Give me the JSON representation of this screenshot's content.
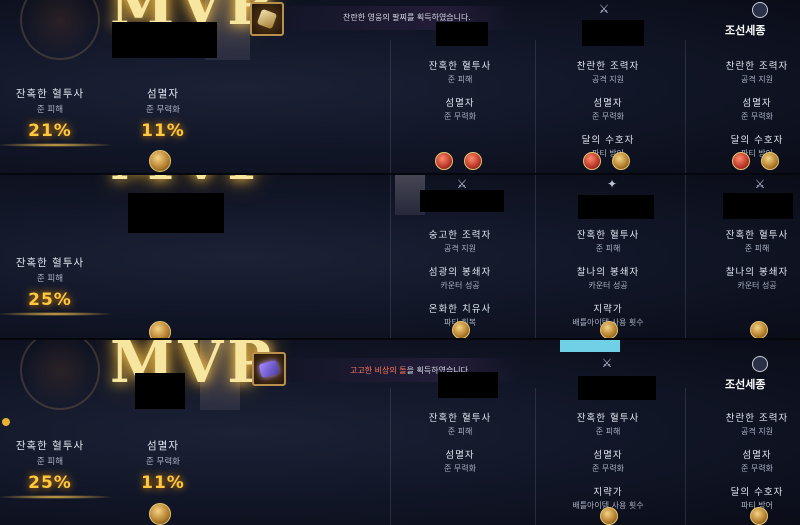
{
  "panel1": {
    "mvp": "MVP",
    "banner": "찬란한 영웅의 팔찌를 획득하였습니다.",
    "mvp_player": {
      "stats": [
        {
          "title": "잔혹한 혈투사",
          "sub": "준 피해",
          "value": "21%"
        },
        {
          "title": "섬멸자",
          "sub": "준 무력화",
          "value": "11%"
        }
      ]
    },
    "members": [
      {
        "stats": [
          {
            "title": "잔혹한 혈투사",
            "sub": "준 피해"
          },
          {
            "title": "섬멸자",
            "sub": "준 무력화"
          }
        ]
      },
      {
        "stats": [
          {
            "title": "찬란한 조력자",
            "sub": "공격 지원"
          },
          {
            "title": "섬멸자",
            "sub": "준 무력화"
          },
          {
            "title": "달의 수호자",
            "sub": "파티 방어"
          }
        ]
      },
      {
        "server": "조선세종",
        "stats": [
          {
            "title": "찬란한 조력자",
            "sub": "공격 지원"
          },
          {
            "title": "섬멸자",
            "sub": "준 무력화"
          },
          {
            "title": "달의 수호자",
            "sub": "파티 방어"
          }
        ]
      }
    ]
  },
  "panel2": {
    "mvp": "MVP",
    "mvp_player": {
      "stats": [
        {
          "title": "잔혹한 혈투사",
          "sub": "준 피해",
          "value": "25%"
        }
      ]
    },
    "members": [
      {
        "stats": [
          {
            "title": "숭고한 조력자",
            "sub": "공격 지원"
          },
          {
            "title": "섬광의 봉쇄자",
            "sub": "카운터 성공"
          },
          {
            "title": "온화한 치유사",
            "sub": "파티 회복"
          }
        ]
      },
      {
        "stats": [
          {
            "title": "잔혹한 혈투사",
            "sub": "준 피해"
          },
          {
            "title": "찰나의 봉쇄자",
            "sub": "카운터 성공"
          },
          {
            "title": "지략가",
            "sub": "배틀아이템 사용 횟수"
          }
        ]
      },
      {
        "stats": [
          {
            "title": "잔혹한 혈투사",
            "sub": "준 피해"
          },
          {
            "title": "찰나의 봉쇄자",
            "sub": "카운터 성공"
          }
        ]
      }
    ]
  },
  "panel3": {
    "mvp": "MVP",
    "banner_pre": "",
    "banner_highlight": "고고한 비상의 돌",
    "banner_post": "을 획득하였습니다.",
    "mvp_player": {
      "stats": [
        {
          "title": "잔혹한 혈투사",
          "sub": "준 피해",
          "value": "25%"
        },
        {
          "title": "섬멸자",
          "sub": "준 무력화",
          "value": "11%"
        }
      ]
    },
    "members": [
      {
        "stats": [
          {
            "title": "잔혹한 혈투사",
            "sub": "준 피해"
          },
          {
            "title": "섬멸자",
            "sub": "준 무력화"
          }
        ]
      },
      {
        "stats": [
          {
            "title": "잔혹한 혈투사",
            "sub": "준 피해"
          },
          {
            "title": "섬멸자",
            "sub": "준 무력화"
          },
          {
            "title": "지략가",
            "sub": "배틀아이템 사용 횟수"
          }
        ]
      },
      {
        "server": "조선세종",
        "stats": [
          {
            "title": "찬란한 조력자",
            "sub": "공격 지원"
          },
          {
            "title": "섬멸자",
            "sub": "준 무력화"
          },
          {
            "title": "달의 수호자",
            "sub": "파티 방어"
          }
        ]
      }
    ]
  }
}
